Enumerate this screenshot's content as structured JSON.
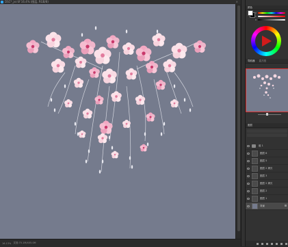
{
  "document": {
    "title": "DSC*_jxr.tif  16.4% (图层, RGB/8)",
    "close_glyph": "×",
    "status_zoom": "16.13%",
    "status_doc": "文档:75.1M/405.0M"
  },
  "color_panel": {
    "tab": "颜色",
    "foreground": "#ffffff",
    "background": "#000000",
    "sliders": [
      {
        "label": "H",
        "gradient": "#ff0000"
      },
      {
        "label": "S",
        "gradient": "#ff7777"
      },
      {
        "label": "B",
        "gradient": "#aaaaaa"
      }
    ]
  },
  "navigator": {
    "tab_active": "导航器",
    "tab_inactive": "直方图"
  },
  "layers": {
    "tab": "图层",
    "items": [
      {
        "name": "组 1",
        "type": "folder",
        "selected": false
      },
      {
        "name": "图层 6",
        "type": "layer",
        "selected": false
      },
      {
        "name": "图层 5",
        "type": "layer",
        "selected": false
      },
      {
        "name": "图层 2 拷贝",
        "type": "layer",
        "selected": false
      },
      {
        "name": "图层 3",
        "type": "layer",
        "selected": false
      },
      {
        "name": "图层 2 拷贝",
        "type": "layer",
        "selected": false
      },
      {
        "name": "图层 2",
        "type": "layer",
        "selected": false
      },
      {
        "name": "图层 1",
        "type": "layer",
        "selected": false
      },
      {
        "name": "背景",
        "type": "image",
        "selected": true
      }
    ]
  },
  "canvas": {
    "background": "#757b8d",
    "image": "cascading pink and white cherry blossom flowers on blue-gray background"
  }
}
